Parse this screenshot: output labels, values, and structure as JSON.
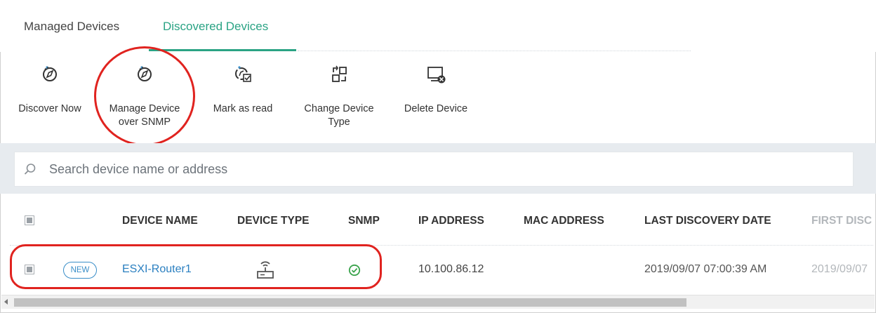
{
  "tabs": [
    {
      "label": "Managed Devices"
    },
    {
      "label": "Discovered Devices"
    }
  ],
  "toolbar": {
    "discover_now": "Discover Now",
    "manage_snmp": "Manage Device\nover SNMP",
    "mark_read": "Mark as read",
    "change_type": "Change Device\nType",
    "delete_device": "Delete Device"
  },
  "search": {
    "placeholder": "Search device name or address"
  },
  "table": {
    "columns": {
      "device_name": "DEVICE NAME",
      "device_type": "DEVICE TYPE",
      "snmp": "SNMP",
      "ip_address": "IP ADDRESS",
      "mac_address": "MAC ADDRESS",
      "last_discovery": "LAST DISCOVERY DATE",
      "first_discovery": "FIRST DISC"
    },
    "rows": [
      {
        "badge": "NEW",
        "device_name": "ESXI-Router1",
        "device_type_icon": "router-icon",
        "snmp_icon": "check-circle-icon",
        "ip_address": "10.100.86.12",
        "mac_address": "",
        "last_discovery": "2019/09/07 07:00:39 AM",
        "first_discovery": "2019/09/07"
      }
    ]
  },
  "colors": {
    "accent": "#2aa384",
    "link": "#2a7fc0",
    "annotation": "#e0231f"
  }
}
